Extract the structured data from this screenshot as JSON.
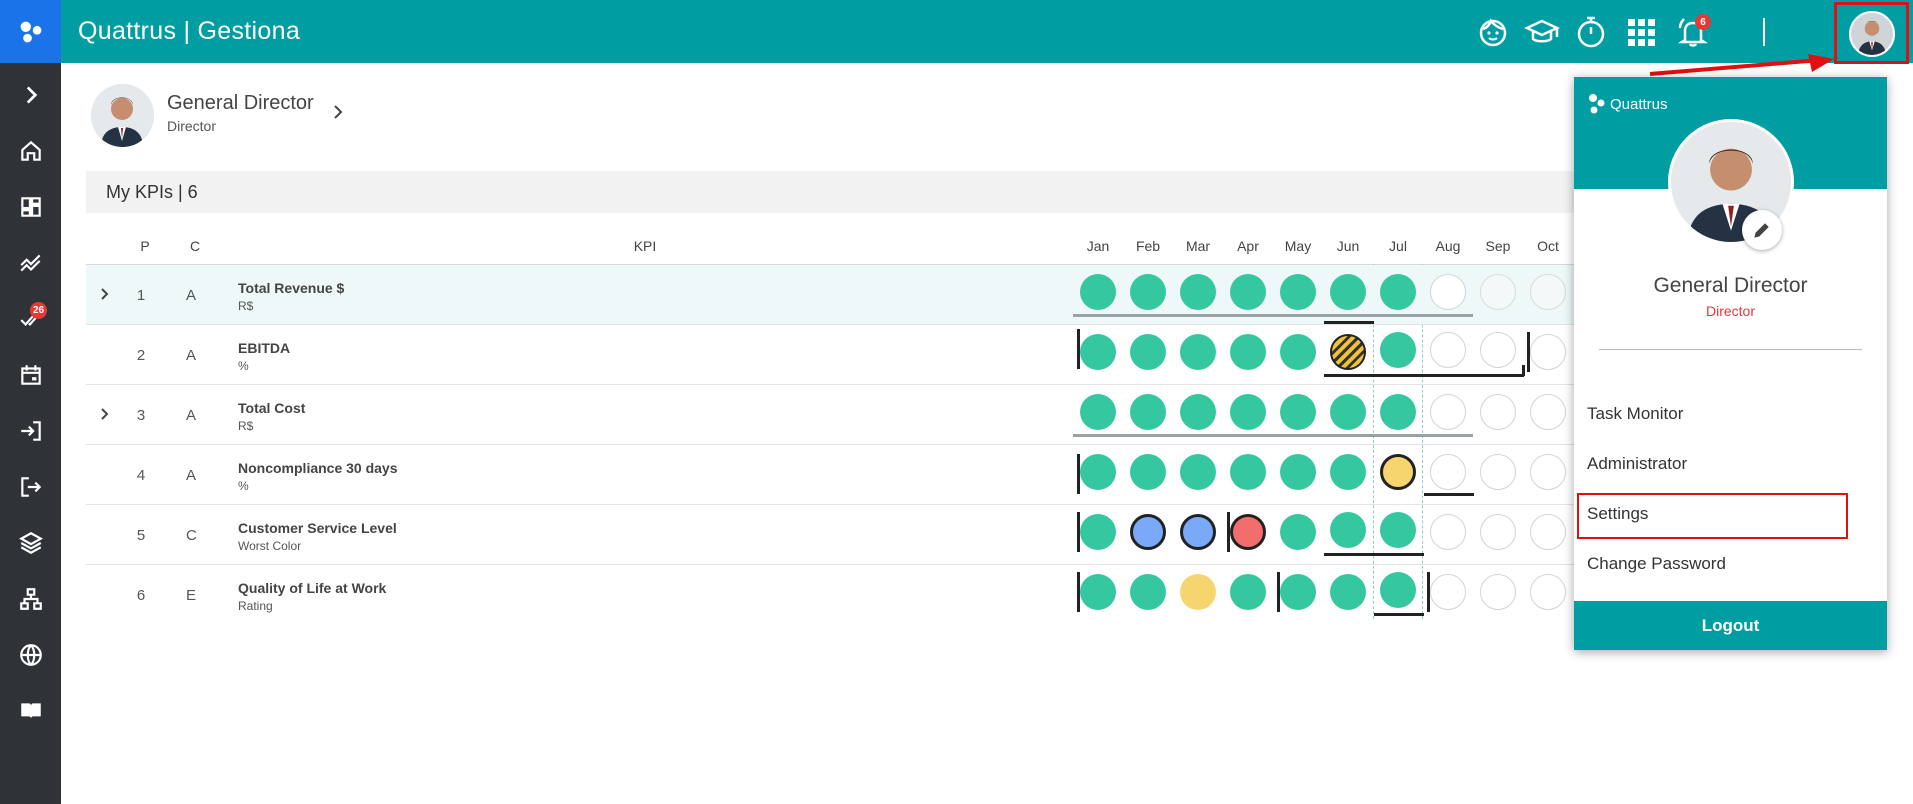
{
  "app": {
    "title": "Quattrus | Gestiona",
    "notifications_count": "6",
    "sidebar_badge": "26"
  },
  "profile": {
    "name": "General Director",
    "role": "Director"
  },
  "kpis": {
    "header": "My KPIs | 6",
    "columns": {
      "p": "P",
      "c": "C",
      "kpi": "KPI"
    },
    "months": [
      "Jan",
      "Feb",
      "Mar",
      "Apr",
      "May",
      "Jun",
      "Jul",
      "Aug",
      "Sep",
      "Oct"
    ],
    "rows": [
      {
        "p": "1",
        "c": "A",
        "name": "Total Revenue $",
        "unit": "R$"
      },
      {
        "p": "2",
        "c": "A",
        "name": "EBITDA",
        "unit": "%"
      },
      {
        "p": "3",
        "c": "A",
        "name": "Total Cost",
        "unit": "R$"
      },
      {
        "p": "4",
        "c": "A",
        "name": "Noncompliance 30 days",
        "unit": "%"
      },
      {
        "p": "5",
        "c": "C",
        "name": "Customer Service Level",
        "unit": "Worst Color"
      },
      {
        "p": "6",
        "c": "E",
        "name": "Quality of Life at Work",
        "unit": "Rating"
      }
    ]
  },
  "dropdown": {
    "brand": "Quattrus",
    "name": "General Director",
    "role": "Director",
    "menu": [
      "Task Monitor",
      "Administrator",
      "Settings",
      "Change Password"
    ],
    "logout": "Logout"
  },
  "colors": {
    "teal": "#009ea3",
    "green_status": "#35c7a0",
    "yellow_status": "#f6d56f",
    "blue_status": "#7aa9f7",
    "red_status": "#f26d6d",
    "sidebar": "#2f3338"
  }
}
